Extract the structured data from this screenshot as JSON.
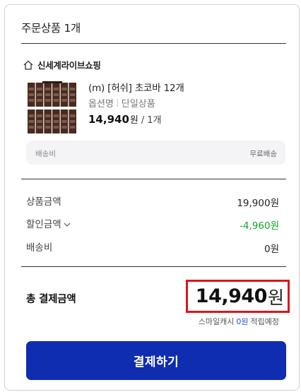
{
  "card": {
    "title": "주문상품 1개"
  },
  "shop": {
    "name": "신세계라이브쇼핑",
    "icon": "home-icon"
  },
  "product": {
    "name": "(m) [허쉬] 초코바 12개",
    "option_label": "옵션명",
    "option_value": "단일상품",
    "price": "14,940",
    "currency": "원",
    "slash": "/",
    "quantity": "1개",
    "thumb_brand": "HERSHEY'S"
  },
  "shipping": {
    "label": "배송비",
    "value": "무료배송"
  },
  "summary": {
    "product_amount_label": "상품금액",
    "product_amount_value": "19,900원",
    "discount_label": "할인금액",
    "discount_value": "-4,960원",
    "shipping_label": "배송비",
    "shipping_value": "0원"
  },
  "total": {
    "label": "총 결제금액",
    "amount": "14,940",
    "currency": "원"
  },
  "points": {
    "prefix": "스마일캐시",
    "value": "0원",
    "suffix": "적립예정"
  },
  "pay_button": {
    "label": "결제하기"
  },
  "colors": {
    "accent": "#0f2db0",
    "discount": "#12a12e",
    "highlight": "#e0141b",
    "point": "#1d4fd8"
  }
}
